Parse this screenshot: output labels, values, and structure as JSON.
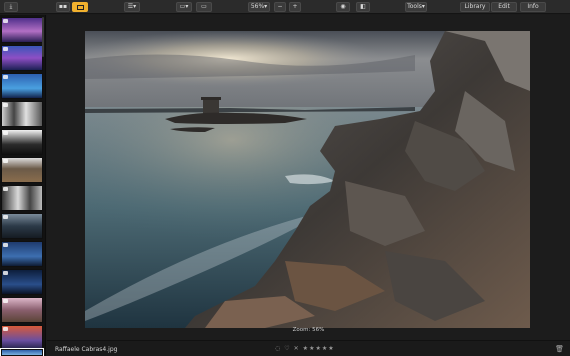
{
  "toolbar": {
    "zoom_value": "56%",
    "tools_label": "Tools",
    "library_label": "Library",
    "edit_label": "Edit",
    "info_label": "Info",
    "icons": [
      "import-icon",
      "compare-icon",
      "single-view-icon",
      "layout-icon",
      "crop-icon",
      "split-view-icon",
      "zoom-out-icon",
      "zoom-in-icon",
      "eye-icon",
      "before-after-icon"
    ]
  },
  "viewer": {
    "zoom_overlay": "Zoom: 56%"
  },
  "statusbar": {
    "filename": "Raffaele Cabras4.jpg",
    "rating_stars": 5,
    "rating_filled": 0,
    "star_glyph": "★"
  },
  "sidebar": {
    "thumbnail_count": 13,
    "selected_index": 12
  },
  "colors": {
    "accent": "#f1b12e",
    "background": "#1b1b1b",
    "toolbar": "#2b2b2b"
  }
}
